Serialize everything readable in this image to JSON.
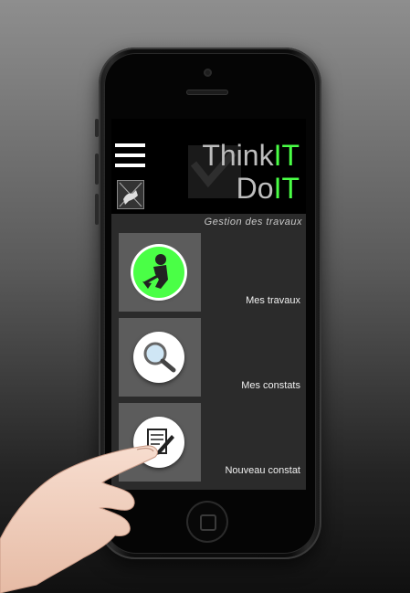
{
  "app": {
    "logo": {
      "think": "Think",
      "it1": "IT",
      "do": "Do",
      "it2": "IT"
    },
    "section_title": "Gestion des travaux"
  },
  "menu": [
    {
      "label": "Mes travaux",
      "icon": "worker-digging-icon"
    },
    {
      "label": "Mes constats",
      "icon": "magnifier-icon"
    },
    {
      "label": "Nouveau constat",
      "icon": "document-edit-icon"
    }
  ],
  "colors": {
    "accent": "#4aff46",
    "screen_bg": "#2b2b2b",
    "card_bg": "#5c5c5c"
  }
}
